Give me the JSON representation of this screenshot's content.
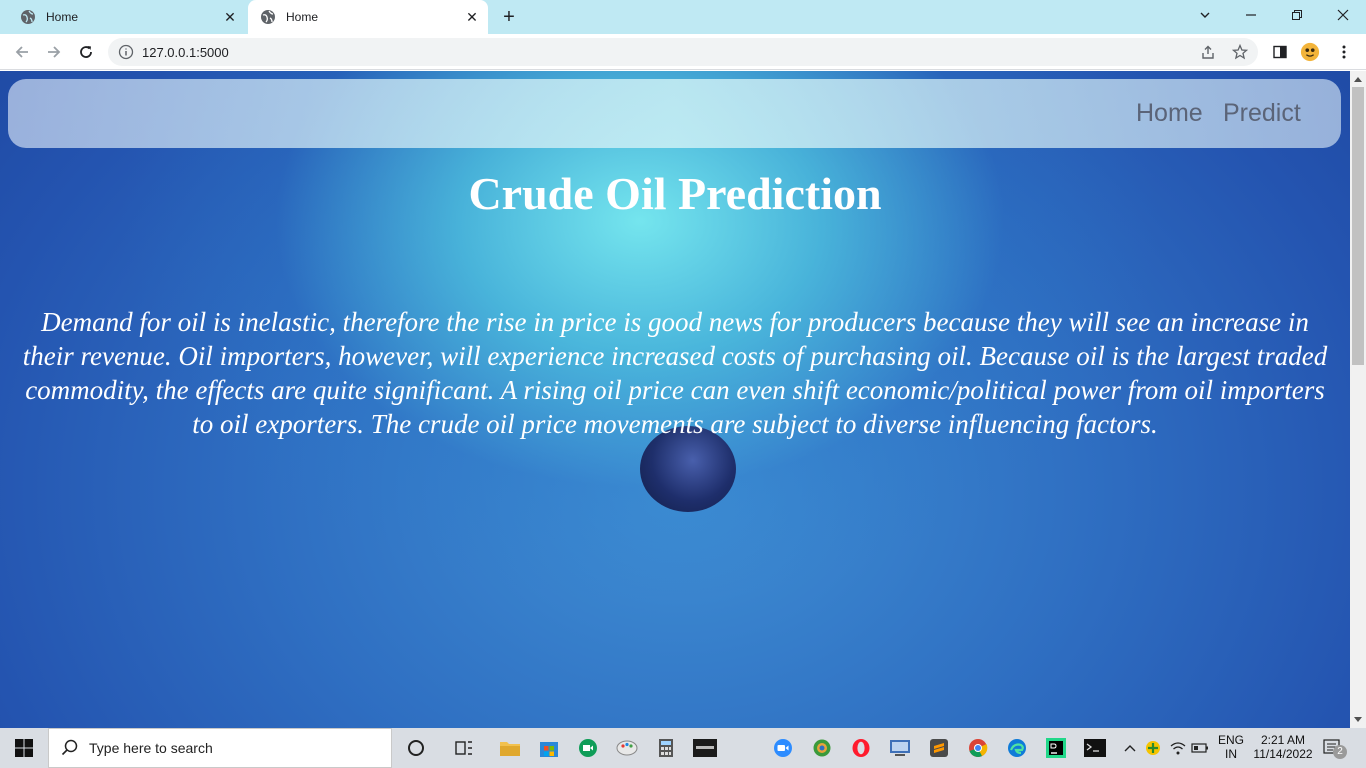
{
  "browser": {
    "tabs": [
      {
        "title": "Home",
        "close_glyph": "✕",
        "icon": "globe-icon"
      },
      {
        "title": "Home",
        "close_glyph": "✕",
        "icon": "globe-icon"
      }
    ],
    "new_tab_glyph": "+",
    "url": "127.0.0.1:5000"
  },
  "page": {
    "nav": {
      "home": "Home",
      "predict": "Predict"
    },
    "title": "Crude Oil Prediction",
    "intro": "Demand for oil is inelastic, therefore the rise in price is good news for producers because they will see an increase in their revenue. Oil importers, however, will experience increased costs of purchasing oil. Because oil is the largest traded commodity, the effects are quite significant. A rising oil price can even shift economic/political power from oil importers to oil exporters. The crude oil price movements are subject to diverse influencing factors."
  },
  "taskbar": {
    "search_placeholder": "Type here to search",
    "language_top": "ENG",
    "language_bottom": "IN",
    "time": "2:21 AM",
    "date": "11/14/2022",
    "notification_count": "2"
  },
  "colors": {
    "tab_strip": "#bfe9f3",
    "page_blue": "#2f6fc2",
    "nav_link": "#5b6478",
    "taskbar": "#d9dde3"
  }
}
